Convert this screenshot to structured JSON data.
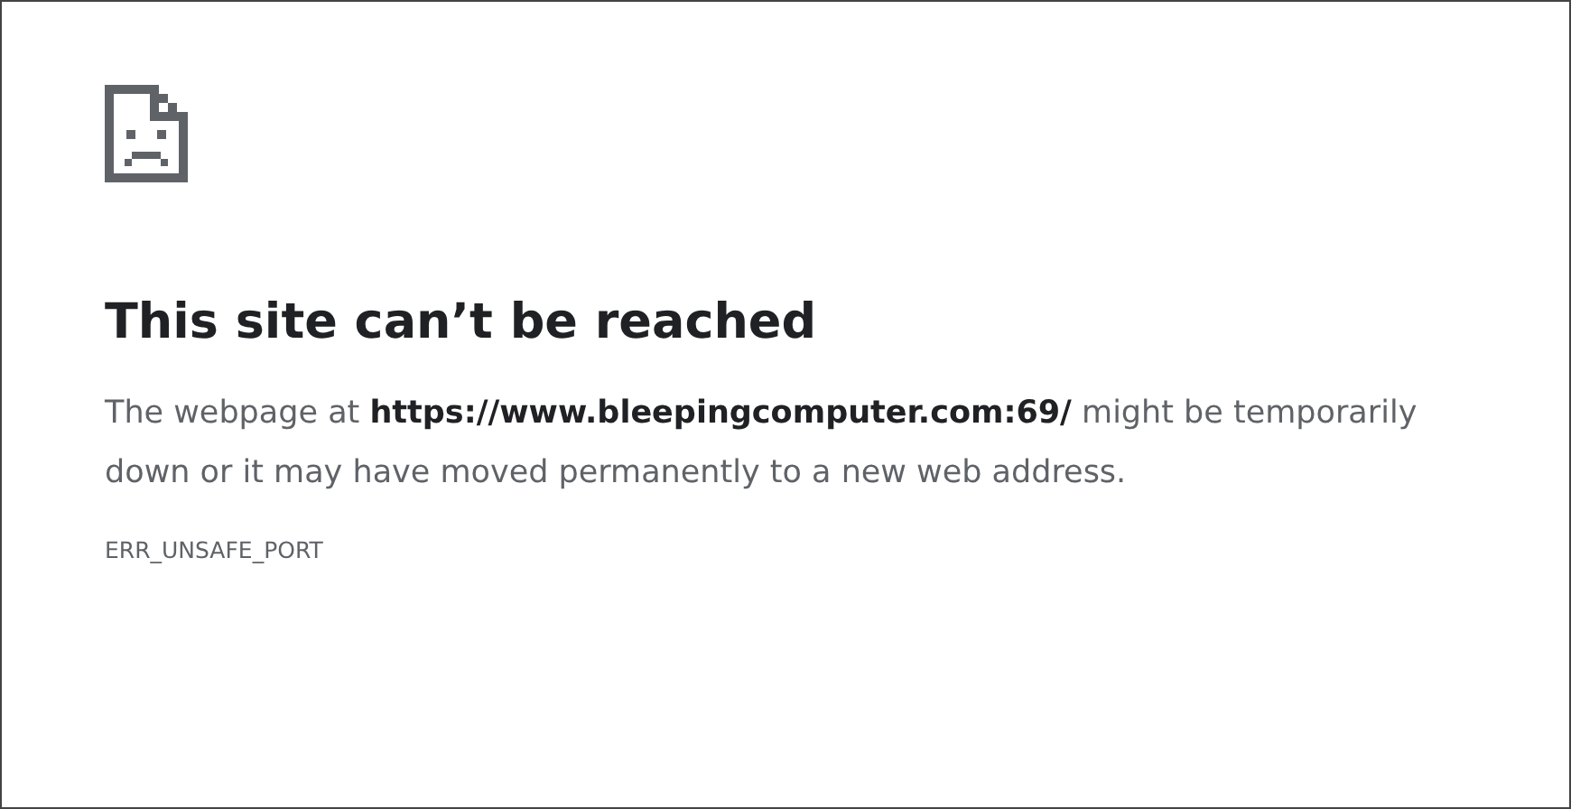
{
  "title": "This site can’t be reached",
  "message": "The webpage at **https://www.bleepingcomputer.com:69/** might be temporarily down or it may have moved permanently to a new web address.",
  "error_code": "ERR_UNSAFE_PORT"
}
